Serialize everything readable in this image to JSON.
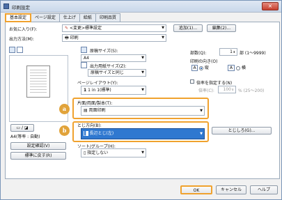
{
  "window": {
    "title": "印刷設定"
  },
  "tabs": [
    "基本設定",
    "ページ設定",
    "仕上げ",
    "給紙",
    "印刷品質"
  ],
  "favorites": {
    "label": "お気に入り(F):",
    "value": "<変更>標準設定",
    "add_button": "追加(1)...",
    "edit_button": "編集(2)..."
  },
  "output_method": {
    "label": "出力方法(M):",
    "value": "印刷"
  },
  "preview": {
    "caption": "A4(等率 : 自動)",
    "settings_button": "設定確認(V)",
    "restore_button": "標準に戻す(R)"
  },
  "original_size": {
    "label": "原稿サイズ(S):",
    "value": "A4"
  },
  "output_paper": {
    "label": "出力用紙サイズ(Z):",
    "value": "原稿サイズと同じ"
  },
  "page_layout": {
    "label": "ページレイアウト(Y):",
    "value": "1 in 1(標準)"
  },
  "print_mode": {
    "label": "片面/両面/製本(T):",
    "value": "両面印刷",
    "badge": "a"
  },
  "binding": {
    "label": "とじ方向(B):",
    "value": "長辺とじ(左)",
    "badge": "b",
    "margin_button": "とじしろ(G)..."
  },
  "sort": {
    "label": "ソート/グループ(H):",
    "value": "指定しない"
  },
  "copies": {
    "label": "部数(Q):",
    "value": "1",
    "unit": "部 (1〜9999)"
  },
  "orientation": {
    "label": "印刷の向き(O)",
    "portrait": "縦",
    "landscape": "横"
  },
  "scaling": {
    "label": "倍率を指定する(N)",
    "ratio_label": "倍率(C):",
    "ratio_value": "100",
    "ratio_unit": "% (25〜200)"
  },
  "buttons": {
    "ok": "OK",
    "cancel": "キャンセル",
    "help": "ヘルプ"
  }
}
